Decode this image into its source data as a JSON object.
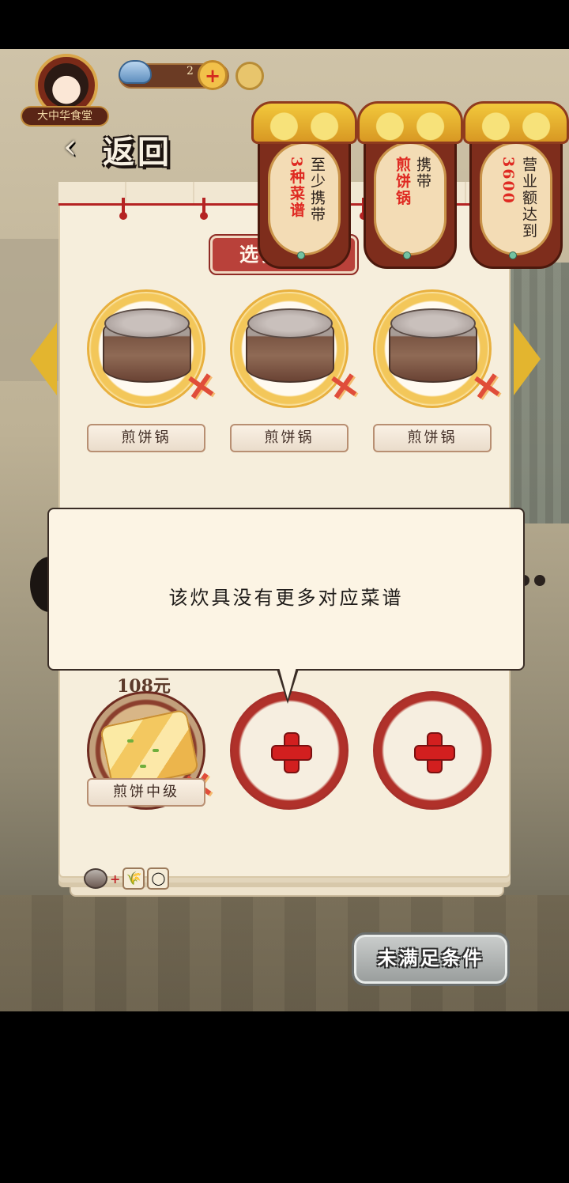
{
  "hud": {
    "restaurant_name": "大中华食堂",
    "currency_value": "2",
    "plus_label": "+"
  },
  "nav": {
    "back_arrow": "‹",
    "back_label": "返回"
  },
  "conditions": [
    {
      "red": "3种菜谱",
      "dark": "至少携带"
    },
    {
      "red": "煎饼锅",
      "dark": "携带"
    },
    {
      "red": "3600",
      "dark": "营业额达到"
    }
  ],
  "cookware_section": {
    "title": "选择锅具",
    "slots": [
      {
        "label": "煎饼锅",
        "remove": "✕"
      },
      {
        "label": "煎饼锅",
        "remove": "✕"
      },
      {
        "label": "煎饼锅",
        "remove": "✕"
      }
    ]
  },
  "tooltip": {
    "message": "该炊具没有更多对应菜谱"
  },
  "recipes": {
    "price": "108元",
    "dish_label": "煎饼中级",
    "remove": "✕",
    "ingredients": [
      {
        "icon": "pot-icon",
        "glyph": ""
      },
      {
        "icon": "plus-sign",
        "glyph": "+"
      },
      {
        "icon": "wheat-icon",
        "glyph": "🌾"
      },
      {
        "icon": "egg-icon",
        "glyph": "◯"
      }
    ]
  },
  "action": {
    "label": "未满足条件"
  },
  "colors": {
    "accent_red": "#b52323",
    "gold": "#e3b52f",
    "parchment": "#f6eedc",
    "disabled_button": "#9a9e9d"
  }
}
